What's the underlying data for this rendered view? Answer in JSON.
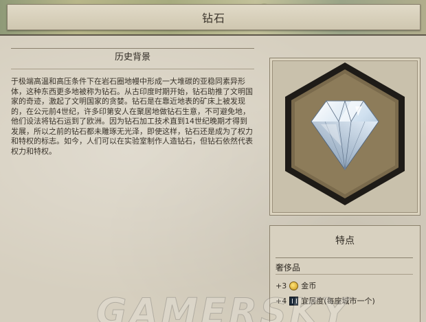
{
  "header": {
    "title": "钻石"
  },
  "history": {
    "heading": "历史背景",
    "body": "于极端高温和高压条件下在岩石圈地幔中形成一大堆碳的亚稳同素异形体，这种东西更多地被称为钻石。从古印度时期开始，钻石助推了文明国家的奇迹，激起了文明国家的贪婪。钻石是在靠近地表的矿床上被发现的，在公元前4世纪，许多印第安人在聚居地做钻石生意，不可避免地，他们设法将钻石运到了欧洲。因为钻石加工技术直到14世纪晚期才得到发展，所以之前的钻石都未雕琢无光泽，即使这样，钻石还是成为了权力和特权的标志。如今，人们可以在实验室制作人造钻石，但钻石依然代表权力和特权。"
  },
  "traits": {
    "heading": "特点",
    "category": "奢侈品",
    "items": [
      {
        "amount": "+3",
        "icon": "gold-coin-icon",
        "label": "金币"
      },
      {
        "amount": "+4",
        "icon": "amenity-icon",
        "label": "宜居度(每座城市一个)"
      }
    ]
  },
  "watermark": "GAMERSKY",
  "colors": {
    "panel": "#d6cfbf",
    "hex_frame": "#1e1b17",
    "hex_inner": "#7a6a4c",
    "text": "#3a342b"
  }
}
